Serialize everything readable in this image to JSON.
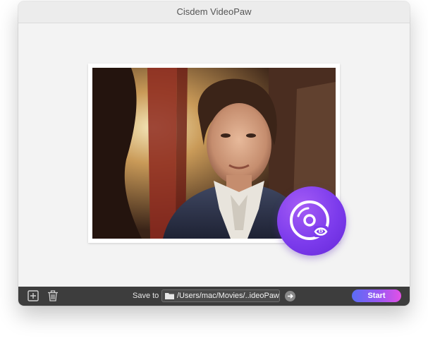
{
  "window": {
    "title": "Cisdem VideoPaw"
  },
  "toolbar": {
    "add_icon": "plus-square-icon",
    "delete_icon": "trash-icon",
    "save_to_label": "Save to",
    "save_path": "/Users/mac/Movies/..ideoPaw",
    "folder_icon": "folder-icon",
    "go_icon": "arrow-right-circle-icon",
    "start_label": "Start"
  },
  "main": {
    "badge_icon": "disc-icon",
    "accent": "#7c3bec",
    "start_gradient": [
      "#5a6cf5",
      "#9a58f2",
      "#e351e6"
    ]
  }
}
